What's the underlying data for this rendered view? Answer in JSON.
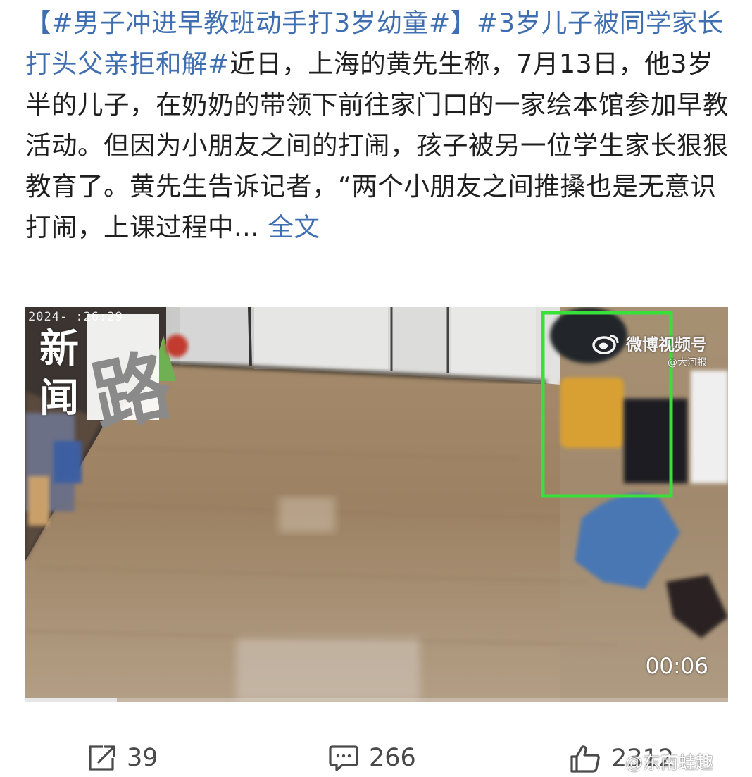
{
  "post": {
    "hashtag1": "【#男子冲进早教班动手打3岁幼童#】",
    "hashtag2": "#3岁儿子被同学家长打头父亲拒和解#",
    "body": "近日，上海的黄先生称，7月13日，他3岁半的儿子，在奶奶的带领下前往家门口的一家绘本馆参加早教活动。但因为小朋友之间的打闹，孩子被另一位学生家长狠狠教育了。黄先生告诉记者，“两个小朋友之间推搡也是无意识打闹，上课过程中...",
    "full_text_link": "全文"
  },
  "video": {
    "timestamp_overlay": "2024-  :26:29",
    "logo_char_1": "新",
    "logo_char_2": "闻",
    "logo_char_3": "路",
    "weibo_label": "微博视频号",
    "weibo_source": "@大河报",
    "current_time": "00:06",
    "progress": 0.13,
    "highlight_box_color": "#38e03a"
  },
  "actions": {
    "share_count": "39",
    "comment_count": "266",
    "like_count": "2312"
  },
  "watermark": "@东南蛙趣",
  "icons": {
    "share": "share-icon",
    "comment": "comment-icon",
    "like": "thumbs-up-icon",
    "weibo": "weibo-logo-icon"
  }
}
